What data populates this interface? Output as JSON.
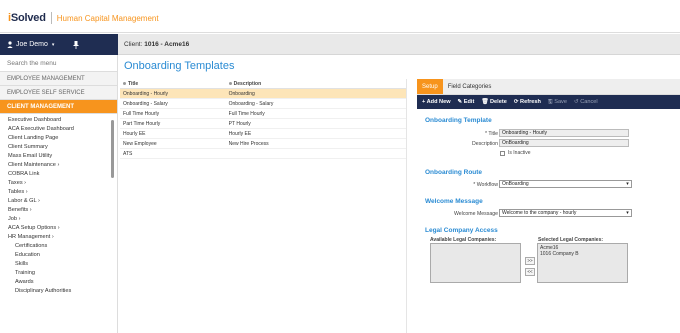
{
  "header": {
    "brand_left": "i",
    "brand_right": "Solved",
    "product": "Human Capital Management"
  },
  "user": {
    "name": "Joe Demo",
    "caret": "▾",
    "pin": "📌"
  },
  "client": {
    "label": "Client:",
    "value": "1016 - Acme16"
  },
  "sidebar": {
    "search_placeholder": "Search the menu",
    "sections": [
      "EMPLOYEE MANAGEMENT",
      "EMPLOYEE SELF SERVICE",
      "CLIENT MANAGEMENT"
    ],
    "items": [
      "Executive Dashboard",
      "ACA Executive Dashboard",
      "Client Landing Page",
      "Client Summary",
      "Mass Email Utility",
      "Client Maintenance  ›",
      "COBRA Link",
      "Taxes  ›",
      "Tables  ›",
      "Labor & GL  ›",
      "Benefits  ›",
      "Job  ›",
      "ACA Setup Options  ›",
      "HR Management  ›"
    ],
    "subitems": [
      "Certifications",
      "Education",
      "Skills",
      "Training",
      "Awards",
      "Disciplinary Authorities"
    ]
  },
  "page": {
    "title": "Onboarding Templates"
  },
  "grid": {
    "col_title": "Title",
    "col_desc": "Description",
    "rows": [
      [
        "Onboarding - Hourly",
        "Onboarding"
      ],
      [
        "Onboarding - Salary",
        "Onboarding - Salary"
      ],
      [
        "Full Time Hourly",
        "Full Time Hourly"
      ],
      [
        "Part Time Hourly",
        "PT Hourly"
      ],
      [
        "Hourly EE",
        "Hourly EE"
      ],
      [
        "New Employee",
        "New Hire Process"
      ],
      [
        "ATS",
        ""
      ]
    ]
  },
  "panel": {
    "tabs": [
      "Setup",
      "Field Categories"
    ],
    "toolbar": {
      "add": "+ Add New",
      "edit": "✎ Edit",
      "delete": "🗑 Delete",
      "refresh": "⟳ Refresh",
      "save": "🖫 Save",
      "cancel": "↺ Cancel"
    },
    "template_section": "Onboarding Template",
    "title_label": "* Title",
    "title_value": "Onboarding - Hourly",
    "desc_label": "Description",
    "desc_value": "OnBoarding",
    "inactive_label": "Is Inactive",
    "route_section": "Onboarding Route",
    "workflow_label": "* Workflow",
    "workflow_value": "OnBoarding",
    "welcome_section": "Welcome Message",
    "welcome_label": "Welcome Message",
    "welcome_value": "Welcome to the company - hourly",
    "legal_section": "Legal Company Access",
    "available_label": "Available Legal Companies:",
    "selected_label": "Selected Legal Companies:",
    "selected_items": [
      "Acme16",
      "1016 Company B"
    ],
    "move_right": ">>",
    "move_left": "<<"
  }
}
